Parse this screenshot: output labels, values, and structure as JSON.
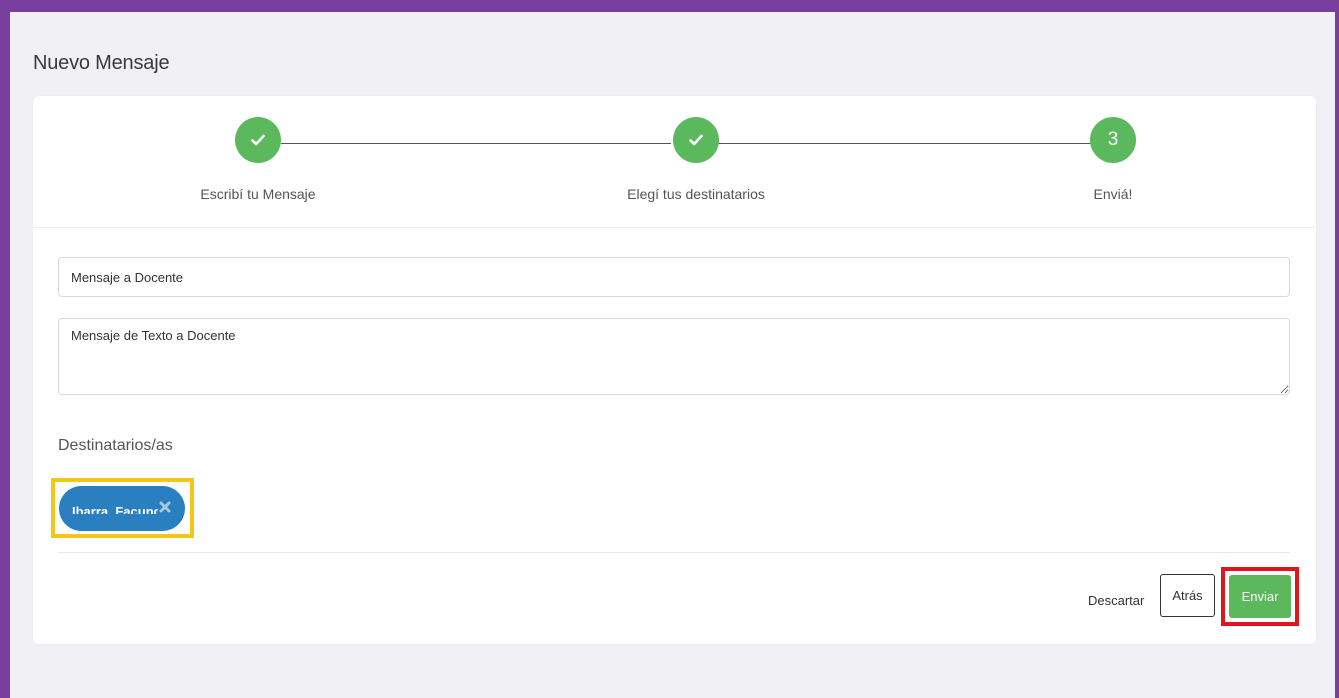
{
  "page": {
    "title": "Nuevo Mensaje"
  },
  "stepper": {
    "steps": [
      {
        "label": "Escribí tu Mensaje",
        "state": "done",
        "icon": "check-icon"
      },
      {
        "label": "Elegí tus destinatarios",
        "state": "done",
        "icon": "check-icon"
      },
      {
        "label": "Enviá!",
        "state": "current",
        "number": "3"
      }
    ],
    "color": "#5cb85c"
  },
  "form": {
    "subject_value": "Mensaje a Docente",
    "body_value": "Mensaje de Texto a Docente"
  },
  "recipients": {
    "label": "Destinatarios/as",
    "chips": [
      {
        "label": "Ibarra, Facundo",
        "remove_icon": "close-icon"
      }
    ],
    "chip_color": "#2a7fc1"
  },
  "actions": {
    "discard_label": "Descartar",
    "back_label": "Atrás",
    "send_label": "Enviar"
  },
  "highlights": {
    "recipient_color": "#f5c518",
    "send_color": "#e0151b"
  }
}
